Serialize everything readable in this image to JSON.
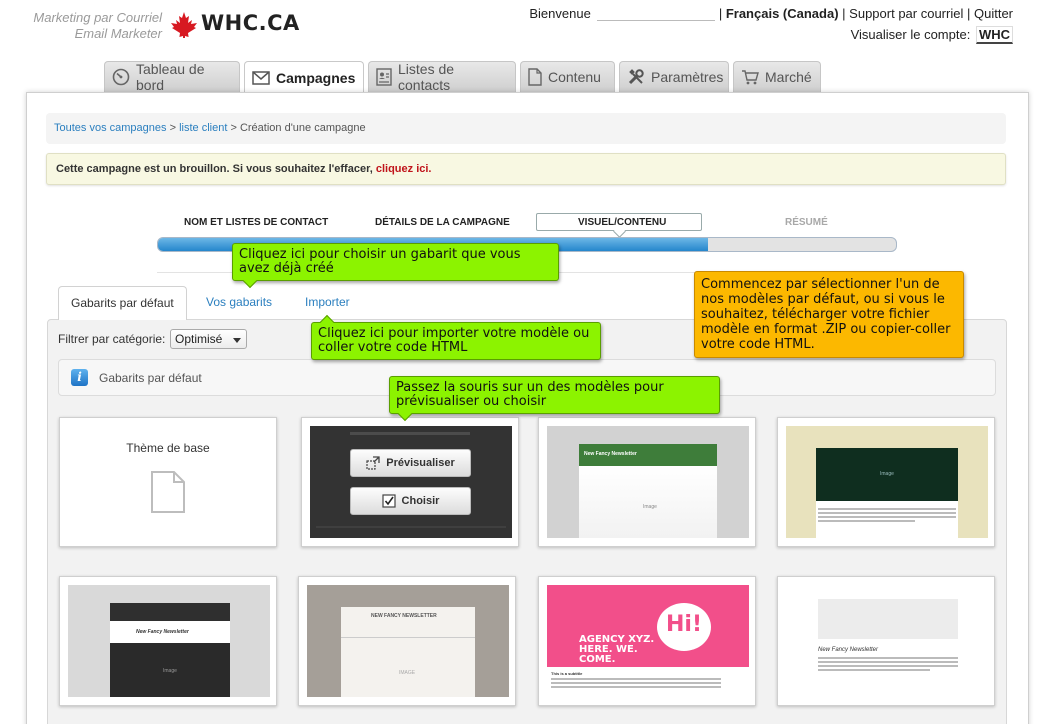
{
  "header": {
    "brand_line_1": "Marketing par Courriel",
    "brand_line_2": "Email Marketer",
    "wordmark": "WHC.CA",
    "welcome": "Bienvenue",
    "language": "Français (Canada)",
    "support": "Support par courriel",
    "quit": "Quitter",
    "view_account_label": "Visualiser le compte:",
    "account": "WHC",
    "sep": "|"
  },
  "tabs": [
    {
      "label": "Tableau de bord",
      "icon": "dashboard-gauge-icon"
    },
    {
      "label": "Campagnes",
      "icon": "envelope-icon"
    },
    {
      "label": "Listes de contacts",
      "icon": "contact-list-icon"
    },
    {
      "label": "Contenu",
      "icon": "document-icon"
    },
    {
      "label": "Paramètres",
      "icon": "tools-icon"
    },
    {
      "label": "Marché",
      "icon": "cart-icon"
    }
  ],
  "breadcrumb": {
    "all_campaigns": "Toutes vos campagnes",
    "sep": ">",
    "client_list": "liste client",
    "current": "Création d'une campagne"
  },
  "draft_notice": {
    "text": "Cette campagne est un brouillon. Si vous souhaitez l'effacer, ",
    "link": "cliquez ici."
  },
  "wizard": {
    "steps": [
      "Nom et listes de contact",
      "Détails de la campagne",
      "Visuel/Contenu",
      "Résumé"
    ],
    "progress": 0.745
  },
  "subtabs": {
    "default": "Gabarits par défaut",
    "yours": "Vos gabarits",
    "import": "Importer"
  },
  "filter": {
    "label": "Filtrer par catégorie:",
    "selected": "Optimisé"
  },
  "info_bar": {
    "icon": "i",
    "title": "Gabarits par défaut"
  },
  "cards": {
    "base_theme": "Thème de base",
    "preview_btn": "Prévisualiser",
    "choose_btn": "Choisir",
    "newsletter_title": "New Fancy Newsletter",
    "newsletter_title_upper": "NEW FANCY NEWSLETTER",
    "image_ph": "Image",
    "image_ph_upper": "IMAGE",
    "subtitle": "This is a subtitle",
    "agency": "AGENCY XYZ.",
    "here": "HERE. WE. COME.",
    "hi": "Hi!"
  },
  "tips": {
    "yours": "Cliquez ici pour choisir un gabarit que vous avez déjà créé",
    "import": "Cliquez ici pour importer votre modèle ou coller votre code HTML",
    "hover": "Passez la souris sur un des modèles pour prévisualiser ou choisir",
    "start": "Commencez par sélectionner l'un de nos modèles par défaut, ou si vous le souhaitez, télécharger votre fichier modèle en format .ZIP ou copier-coller votre code HTML."
  },
  "colors": {
    "tip_green": "#8cf300",
    "tip_orange": "#fcb800",
    "link_blue": "#2b7fbf",
    "danger_red": "#c0141b",
    "progress_blue": "#2586cc"
  }
}
